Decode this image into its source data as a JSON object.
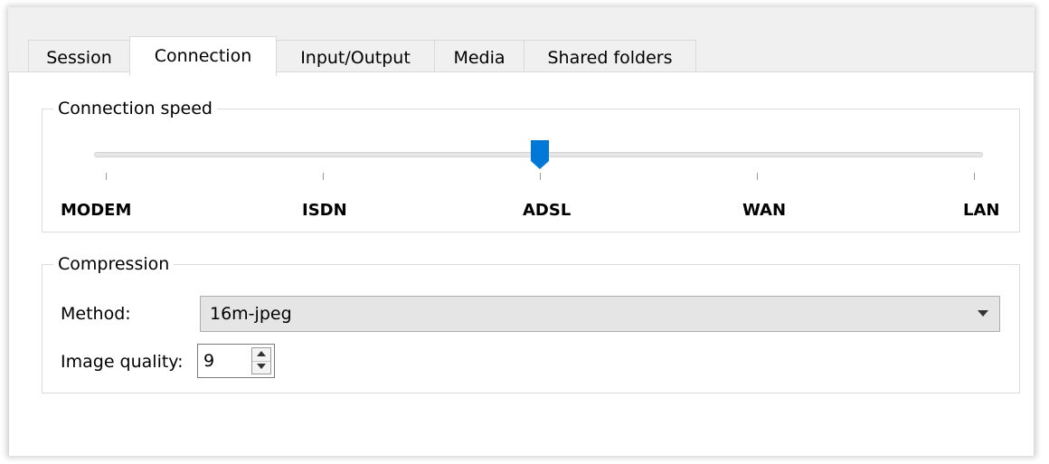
{
  "tabs": [
    {
      "label": "Session",
      "active": false
    },
    {
      "label": "Connection",
      "active": true
    },
    {
      "label": "Input/Output",
      "active": false
    },
    {
      "label": "Media",
      "active": false
    },
    {
      "label": "Shared folders",
      "active": false
    }
  ],
  "connection_speed": {
    "title": "Connection speed",
    "levels": [
      "MODEM",
      "ISDN",
      "ADSL",
      "WAN",
      "LAN"
    ],
    "selected": "ADSL",
    "selected_index": 2,
    "handle_color": "#0078d7"
  },
  "compression": {
    "title": "Compression",
    "method_label": "Method:",
    "method_value": "16m-jpeg",
    "quality_label": "Image quality:",
    "quality_value": "9"
  }
}
